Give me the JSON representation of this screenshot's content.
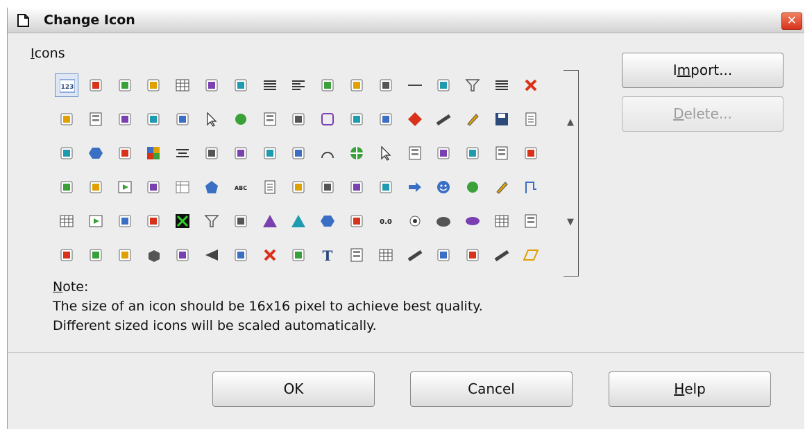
{
  "dialog": {
    "title": "Change Icon",
    "icons_label": "Icons",
    "note_label": "Note:",
    "note_line1": "The size of an icon should be 16x16 pixel to achieve best quality.",
    "note_line2": "Different sized icons will be scaled automatically."
  },
  "buttons": {
    "import": "Import...",
    "delete": "Delete...",
    "ok": "OK",
    "cancel": "Cancel",
    "help": "Help"
  },
  "icon_grid": {
    "selected_icon": "number-format-icon",
    "rows": [
      [
        "number-format-icon",
        "insert-field-icon",
        "shapes-icon",
        "database-icon",
        "table-icon",
        "frame-icon",
        "sort-ascending-icon",
        "align-justify-icon",
        "align-left-icon",
        "formula-icon",
        "table-insert-icon",
        "back-icon",
        "horizontal-line-icon",
        "chart-icon",
        "filter-icon",
        "align-justify-icon",
        "close-icon"
      ],
      [
        "currency-icon",
        "form-icon",
        "columns-icon",
        "chart-icon",
        "settings-icon",
        "pointer-icon",
        "circle-icon",
        "form-icon",
        "paragraph-icon",
        "rectangle-icon",
        "wand-icon",
        "link-icon",
        "diamond-icon",
        "line-icon",
        "pencil-icon",
        "save-icon",
        "document-icon"
      ],
      [
        "percent-icon",
        "hexagon-icon",
        "monitor-icon",
        "palette-icon",
        "align-center-icon",
        "line-numbers-icon",
        "indent-icon",
        "zoom-icon",
        "paragraph-icon",
        "arc-icon",
        "crosshair-icon",
        "pointer-icon",
        "form-icon",
        "image-icon",
        "spellcheck-icon",
        "form-icon",
        "color-fill-icon"
      ],
      [
        "macro-icon",
        "scroll-icon",
        "play-icon",
        "shape-icon",
        "grid-icon",
        "pentagon-icon",
        "abc-icon",
        "document-icon",
        "arrows-icon",
        "undo-icon",
        "picture-icon",
        "wand-icon",
        "arrow-right-icon",
        "smiley-icon",
        "circle-icon",
        "pencil-icon",
        "connector-icon"
      ],
      [
        "table-icon",
        "play-icon",
        "shield-icon",
        "calendar-icon",
        "x-box-icon",
        "filter-icon",
        "font-size-icon",
        "triangle-icon",
        "triangle-icon",
        "hexagon-icon",
        "data-icon",
        "number-icon",
        "radio-icon",
        "cloud-icon",
        "ellipse-icon",
        "table-icon",
        "form-icon",
        "binoculars-icon"
      ],
      [
        "pin-icon",
        "rotate-icon",
        "fontwork-icon",
        "cube-icon",
        "font-color-icon",
        "triangle-left-icon",
        "move-icon",
        "close-icon",
        "zoom-icon",
        "text-icon",
        "form-icon",
        "table-icon",
        "line-icon",
        "lamp-icon",
        "ruler-icon",
        "line-icon",
        "parallelogram-icon"
      ]
    ]
  },
  "colors": {
    "close_button": "#d8321a",
    "selected_border": "#6b8fc7"
  }
}
